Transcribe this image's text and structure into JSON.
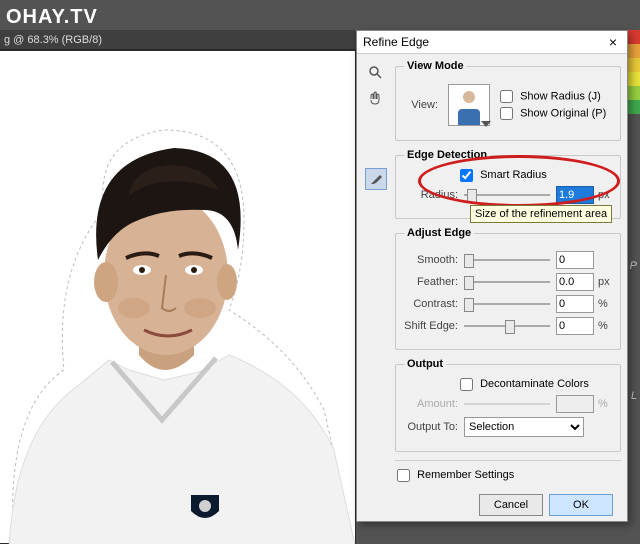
{
  "watermark": "OHAY.TV",
  "doc_title": "g @ 68.3% (RGB/8)",
  "side": {
    "p": "P",
    "l": "L"
  },
  "dialog": {
    "title": "Refine Edge",
    "close": "×",
    "view_mode": {
      "legend": "View Mode",
      "view_label": "View:",
      "show_radius": "Show Radius (J)",
      "show_original": "Show Original (P)"
    },
    "edge_detection": {
      "legend": "Edge Detection",
      "smart_radius": "Smart Radius",
      "radius_label": "Radius:",
      "radius_value": "1.9",
      "radius_unit": "px",
      "tooltip": "Size of the refinement area"
    },
    "adjust_edge": {
      "legend": "Adjust Edge",
      "smooth_label": "Smooth:",
      "smooth_value": "0",
      "feather_label": "Feather:",
      "feather_value": "0.0",
      "feather_unit": "px",
      "contrast_label": "Contrast:",
      "contrast_value": "0",
      "contrast_unit": "%",
      "shift_label": "Shift Edge:",
      "shift_value": "0",
      "shift_unit": "%"
    },
    "output": {
      "legend": "Output",
      "decontaminate": "Decontaminate Colors",
      "amount_label": "Amount:",
      "amount_unit": "%",
      "output_to_label": "Output To:",
      "output_to_value": "Selection"
    },
    "remember": "Remember Settings",
    "cancel": "Cancel",
    "ok": "OK"
  }
}
